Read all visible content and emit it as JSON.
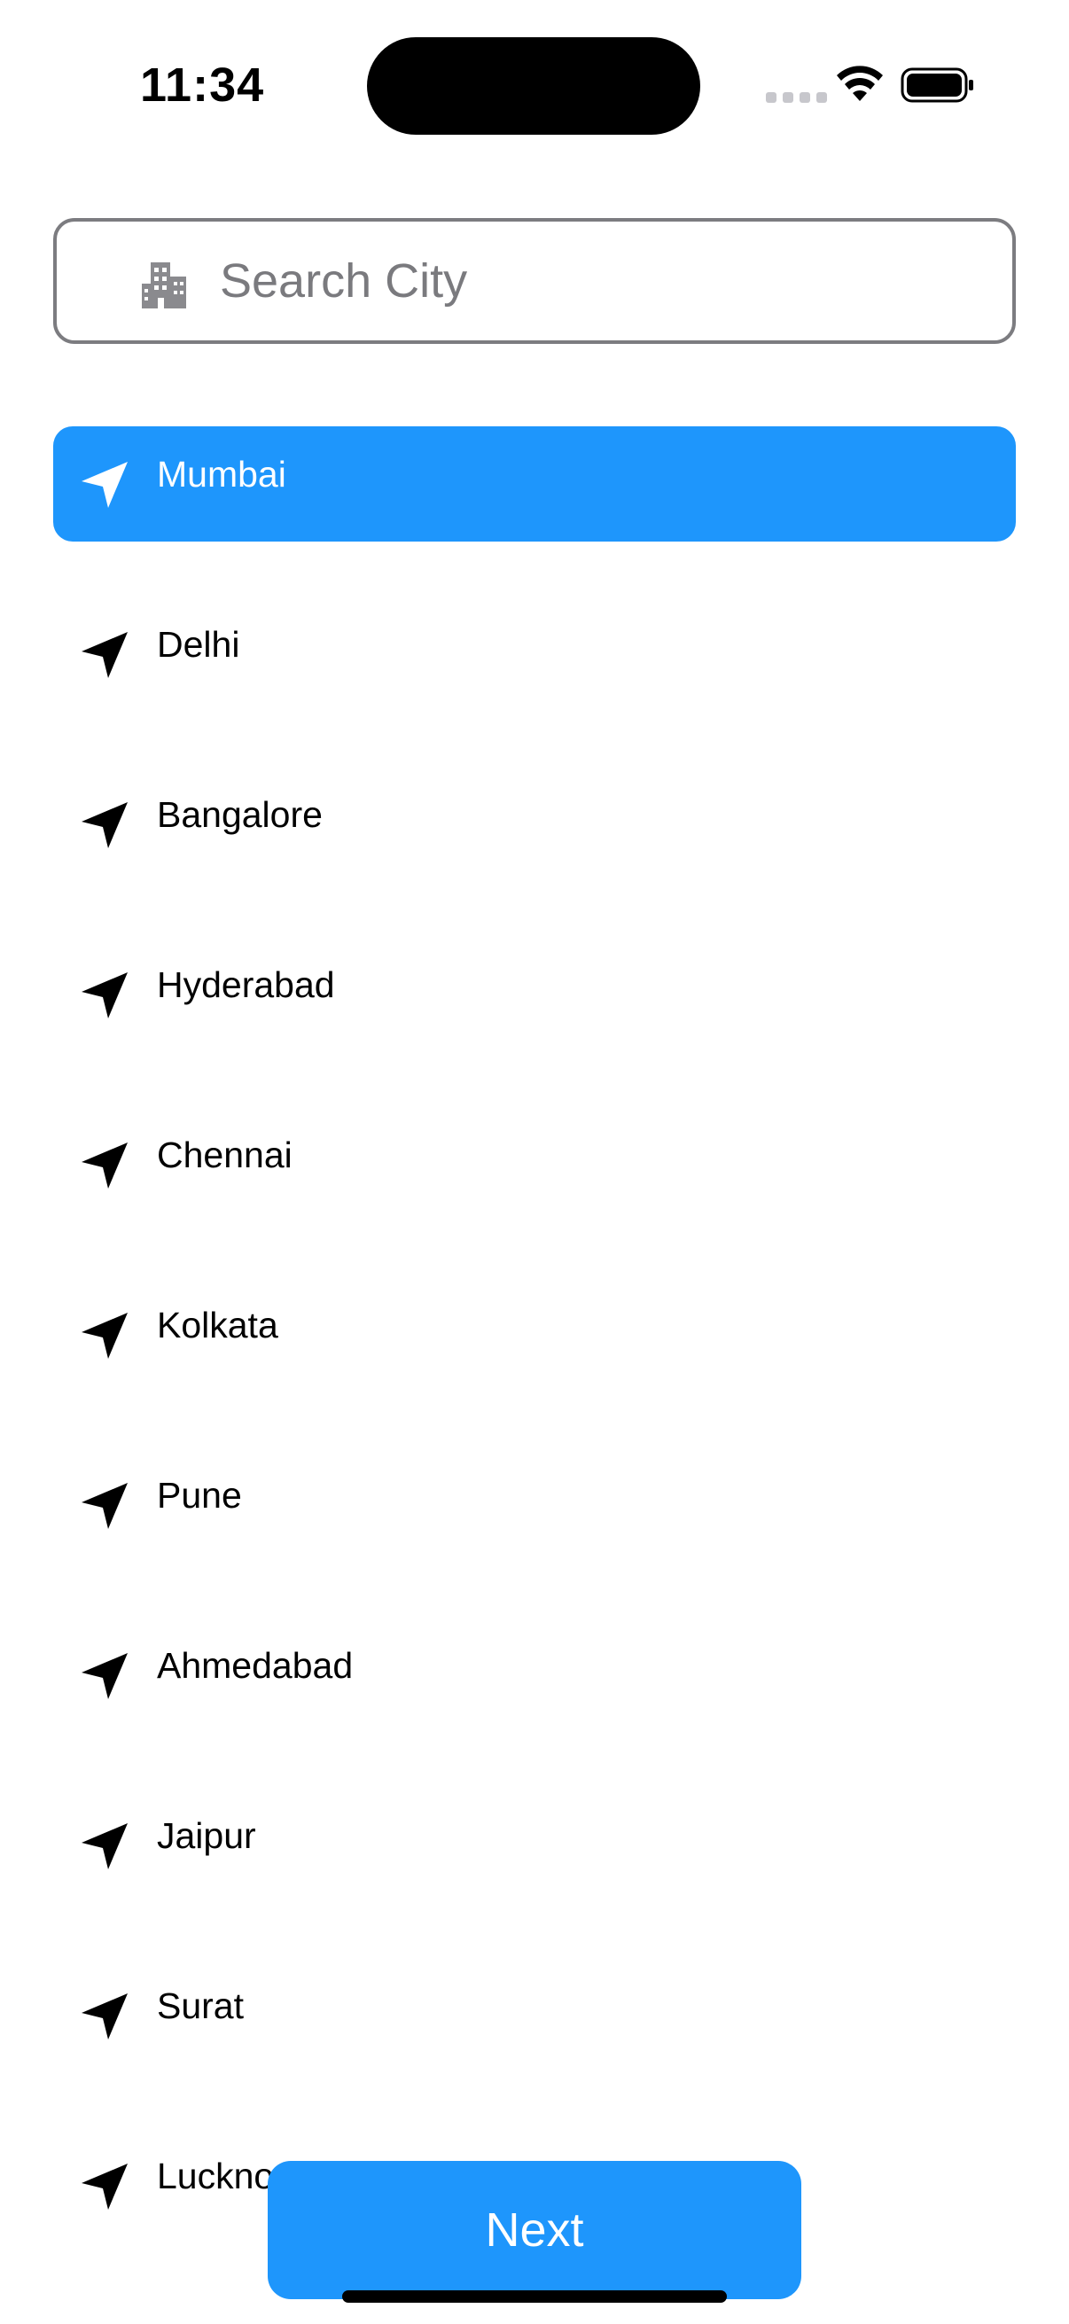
{
  "status_bar": {
    "time": "11:34",
    "signal_icon": "cellular-signal-icon",
    "wifi_icon": "wifi-icon",
    "battery_icon": "battery-icon"
  },
  "search": {
    "placeholder": "Search City",
    "value": "",
    "icon": "building-icon"
  },
  "cities": [
    {
      "label": "Mumbai",
      "selected": true
    },
    {
      "label": "Delhi",
      "selected": false
    },
    {
      "label": "Bangalore",
      "selected": false
    },
    {
      "label": "Hyderabad",
      "selected": false
    },
    {
      "label": "Chennai",
      "selected": false
    },
    {
      "label": "Kolkata",
      "selected": false
    },
    {
      "label": "Pune",
      "selected": false
    },
    {
      "label": "Ahmedabad",
      "selected": false
    },
    {
      "label": "Jaipur",
      "selected": false
    },
    {
      "label": "Surat",
      "selected": false
    },
    {
      "label": "Lucknow",
      "selected": false
    }
  ],
  "list_icon": "location-arrow-icon",
  "next_button": {
    "label": "Next"
  },
  "colors": {
    "accent": "#1e96fc",
    "selected_text": "#ffffff",
    "text": "#000000",
    "placeholder": "#7a7a7e",
    "border": "#7c7c80"
  }
}
